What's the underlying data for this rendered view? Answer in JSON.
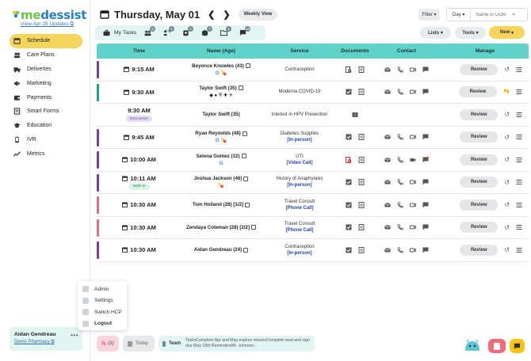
{
  "app": {
    "logo_text_me": "me",
    "logo_text_dessist": "dessist",
    "update_link": "View Apr 28 Updates"
  },
  "sidebar": {
    "items": [
      {
        "label": "Schedule",
        "icon": "calendar-icon",
        "active": true
      },
      {
        "label": "Care Plans",
        "icon": "people-icon"
      },
      {
        "label": "Deliveries",
        "icon": "truck-icon"
      },
      {
        "label": "Marketing",
        "icon": "megaphone-icon"
      },
      {
        "label": "Payments",
        "icon": "wallet-icon"
      },
      {
        "label": "Smart Forms",
        "icon": "forms-icon"
      },
      {
        "label": "Education",
        "icon": "graduation-cap-icon"
      },
      {
        "label": "IVR",
        "icon": "phone-icon"
      },
      {
        "label": "Metrics",
        "icon": "chart-icon"
      }
    ]
  },
  "user_menu": {
    "items": [
      "Admin",
      "Settings",
      "Switch HCP",
      "Logout"
    ]
  },
  "user": {
    "name": "Aidan Gendreau",
    "pharmacy": "Demo Pharmacy"
  },
  "header": {
    "date": "Thursday, May 01",
    "prev": "❮",
    "next": "❯",
    "weekly_view": "Weekly View",
    "filter": "Filter",
    "day_select": "Day",
    "search_placeholder": "Name or DOB"
  },
  "task_bar": {
    "label": "My Tasks",
    "badges": [
      "0",
      "1",
      "1",
      "7",
      "1",
      "24"
    ]
  },
  "actions": {
    "lists": "Lists",
    "tools": "Tools",
    "new": "New"
  },
  "table": {
    "headers": [
      "Time",
      "Name (Age)",
      "Service",
      "Documents",
      "Contact",
      "Manage"
    ],
    "review_label": "Review",
    "rows": [
      {
        "time": "9:15 AM",
        "name": "Beyonce Knowles (43)",
        "service": "Contraception",
        "mode": "",
        "tag": "",
        "bar": "#7b3f98"
      },
      {
        "time": "9:30 AM",
        "name": "Taylor Swift (35)",
        "service": "Moderna COVID-19",
        "mode": "",
        "tag": "",
        "bar": "#1f9e8e"
      },
      {
        "time": "9:30 AM",
        "name": "Taylor Swift (35)",
        "service": "Interest in HPV Prevention",
        "mode": "",
        "tag": "Discussion",
        "bar": ""
      },
      {
        "time": "9:45 AM",
        "name": "Ryan Reynolds (48)",
        "service": "Diabetes Supplies",
        "mode": "[In-person]",
        "tag": "",
        "bar": "#7b3f98"
      },
      {
        "time": "10:00 AM",
        "name": "Selena Gomez (32)",
        "service": "UTI",
        "mode": "[Video Call]",
        "tag": "",
        "bar": "#7b3f98"
      },
      {
        "time": "10:11 AM",
        "name": "Joshua Jackson (46)",
        "service": "History of Anaphylaxis",
        "mode": "[In-person]",
        "tag": "Walk-In",
        "bar": "#7b3f98"
      },
      {
        "time": "10:30 AM",
        "name": "Tom Holland (28) [1/2]",
        "service": "Travel Consult",
        "mode": "[Phone Call]",
        "tag": "",
        "bar": "#d9707e"
      },
      {
        "time": "10:30 AM",
        "name": "Zendaya Coleman (28) [2/2]",
        "service": "Travel Consult",
        "mode": "[Phone Call]",
        "tag": "",
        "bar": "#d9707e"
      },
      {
        "time": "10:30 AM",
        "name": "Aidan Gendreau (24)",
        "service": "Contraception",
        "mode": "[In-person]",
        "tag": "",
        "bar": "#7b3f98"
      }
    ]
  },
  "bottom": {
    "rx_count": "(1)",
    "today": "Today",
    "team": "Team",
    "team_message": "TasksComplete Apr and May expires returnsComplete read and sign due May 18th RemindersMr. Johnson..."
  },
  "colors": {
    "accent_yellow": "#f5d55b",
    "table_header": "#5fd3c9",
    "task_bar_bg": "#e2f5f3"
  }
}
